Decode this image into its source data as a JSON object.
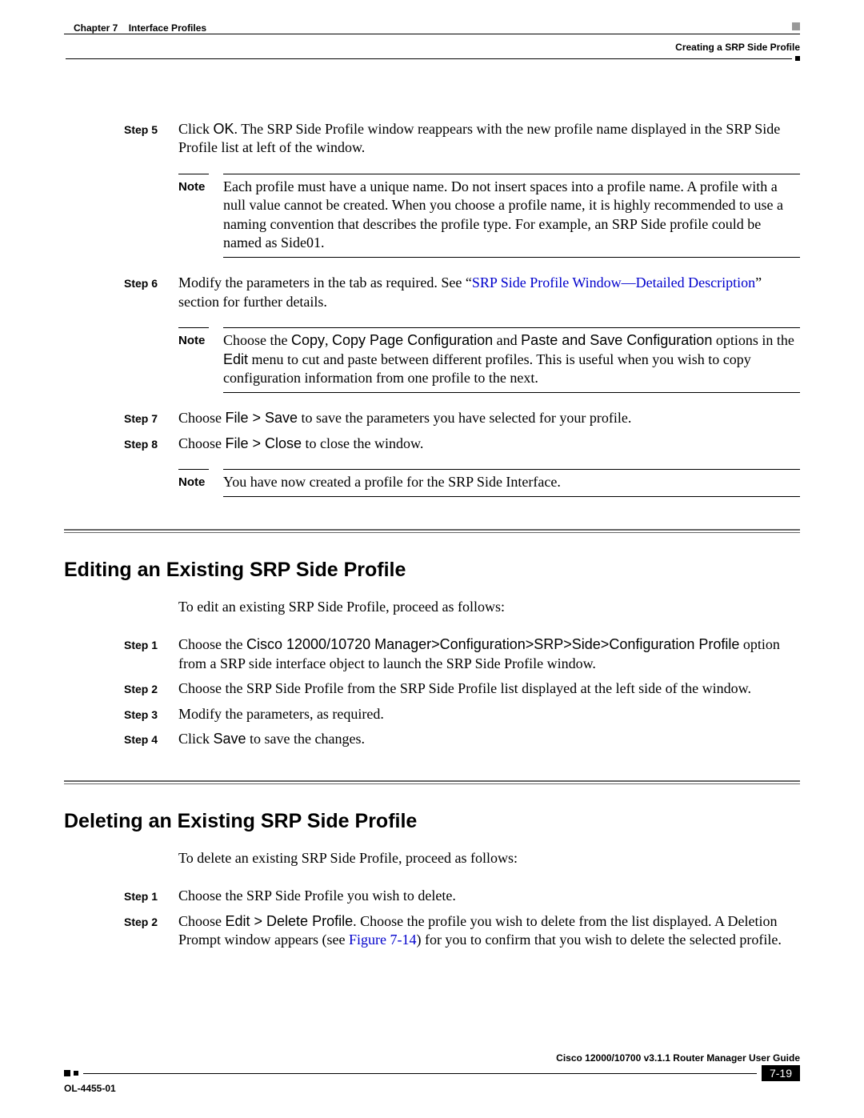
{
  "header": {
    "chapter_label": "Chapter 7",
    "chapter_title": "Interface Profiles",
    "section": "Creating a SRP Side Profile"
  },
  "steps_a": {
    "s5": {
      "label": "Step 5",
      "pre": "Click ",
      "ui": "OK",
      "post": ". The SRP Side Profile window reappears with the new profile name displayed in the SRP Side Profile list at left of the window."
    },
    "s6": {
      "label": "Step 6",
      "pre1": "Modify the parameters in the tab as required. See “",
      "link": "SRP Side Profile Window—Detailed Description",
      "post1": "” section for further details."
    },
    "s7": {
      "label": "Step 7",
      "pre": "Choose ",
      "ui": "File > Save",
      "post": " to save the parameters you have selected for your profile."
    },
    "s8": {
      "label": "Step 8",
      "pre": "Choose ",
      "ui": "File > Close",
      "post": " to close the window."
    }
  },
  "notes": {
    "label": "Note",
    "n1": "Each profile must have a unique name. Do not insert spaces into a profile name. A profile with a null value cannot be created. When you choose a profile name, it is highly recommended to use a naming convention that describes the profile type. For example, an SRP Side profile could be named as Side01.",
    "n2_pre": "Choose the ",
    "n2_ui1": "Copy",
    "n2_mid1": ", ",
    "n2_ui2": "Copy Page Configuration",
    "n2_mid2": " and ",
    "n2_ui3": "Paste and Save Configuration",
    "n2_mid3": " options in the ",
    "n2_ui4": "Edit",
    "n2_post": " menu to cut and paste between different profiles. This is useful when you wish to copy configuration information from one profile to the next.",
    "n3": "You have now created a profile for the SRP Side Interface."
  },
  "edit": {
    "heading": "Editing an Existing SRP Side Profile",
    "intro": "To edit an existing SRP Side Profile, proceed as follows:",
    "s1": {
      "label": "Step 1",
      "pre": "Choose the ",
      "ui": "Cisco 12000/10720 Manager>Configuration>SRP>Side>Configuration Profile",
      "post": " option from a SRP side interface object to launch the SRP Side Profile window."
    },
    "s2": {
      "label": "Step 2",
      "text": "Choose the SRP Side Profile from the SRP Side Profile list displayed at the left side of the window."
    },
    "s3": {
      "label": "Step 3",
      "text": "Modify the parameters, as required."
    },
    "s4": {
      "label": "Step 4",
      "pre": "Click ",
      "ui": "Save",
      "post": " to save the changes."
    }
  },
  "del": {
    "heading": "Deleting an Existing SRP Side Profile",
    "intro": "To delete an existing SRP Side Profile, proceed as follows:",
    "s1": {
      "label": "Step 1",
      "text": "Choose the SRP Side Profile you wish to delete."
    },
    "s2": {
      "label": "Step 2",
      "pre": "Choose ",
      "ui": "Edit > Delete Profile",
      "mid": ". Choose the profile you wish to delete from the list displayed. A Deletion Prompt window appears (see ",
      "link": "Figure 7-14",
      "post": ") for you to confirm that you wish to delete the selected profile."
    }
  },
  "footer": {
    "publication": "Cisco 12000/10700 v3.1.1 Router Manager User Guide",
    "page": "7-19",
    "ol": "OL-4455-01"
  }
}
